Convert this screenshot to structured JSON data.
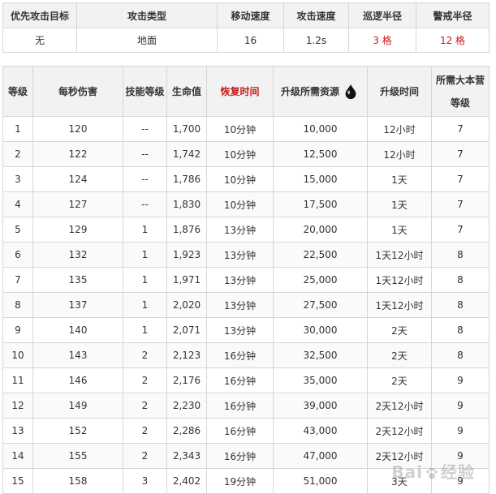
{
  "top": {
    "headers": [
      "优先攻击目标",
      "攻击类型",
      "移动速度",
      "攻击速度",
      "巡逻半径",
      "警戒半径"
    ],
    "values": [
      "无",
      "地面",
      "16",
      "1.2s",
      "3 格",
      "12 格"
    ]
  },
  "table": {
    "headers": [
      "等级",
      "每秒伤害",
      "技能等级",
      "生命值",
      "恢复时间",
      "升级所需资源",
      "升级时间",
      "所需大本营等级"
    ],
    "rows": [
      [
        "1",
        "120",
        "--",
        "1,700",
        "10分钟",
        "10,000",
        "12小时",
        "7"
      ],
      [
        "2",
        "122",
        "--",
        "1,742",
        "10分钟",
        "12,500",
        "12小时",
        "7"
      ],
      [
        "3",
        "124",
        "--",
        "1,786",
        "10分钟",
        "15,000",
        "1天",
        "7"
      ],
      [
        "4",
        "127",
        "--",
        "1,830",
        "10分钟",
        "17,500",
        "1天",
        "7"
      ],
      [
        "5",
        "129",
        "1",
        "1,876",
        "13分钟",
        "20,000",
        "1天",
        "7"
      ],
      [
        "6",
        "132",
        "1",
        "1,923",
        "13分钟",
        "22,500",
        "1天12小时",
        "8"
      ],
      [
        "7",
        "135",
        "1",
        "1,971",
        "13分钟",
        "25,000",
        "1天12小时",
        "8"
      ],
      [
        "8",
        "137",
        "1",
        "2,020",
        "13分钟",
        "27,500",
        "1天12小时",
        "8"
      ],
      [
        "9",
        "140",
        "1",
        "2,071",
        "13分钟",
        "30,000",
        "2天",
        "8"
      ],
      [
        "10",
        "143",
        "2",
        "2,123",
        "16分钟",
        "32,500",
        "2天",
        "8"
      ],
      [
        "11",
        "146",
        "2",
        "2,176",
        "16分钟",
        "35,000",
        "2天",
        "9"
      ],
      [
        "12",
        "149",
        "2",
        "2,230",
        "16分钟",
        "39,000",
        "2天12小时",
        "9"
      ],
      [
        "13",
        "152",
        "2",
        "2,286",
        "16分钟",
        "43,000",
        "2天12小时",
        "9"
      ],
      [
        "14",
        "155",
        "2",
        "2,343",
        "16分钟",
        "47,000",
        "2天12小时",
        "9"
      ],
      [
        "15",
        "158",
        "3",
        "2,402",
        "19分钟",
        "51,000",
        "3天",
        "9"
      ]
    ]
  },
  "watermark": {
    "text_left": "Bai",
    "text_right": "经验"
  },
  "icons": {
    "resource": "dark-elixir-drop-icon",
    "watermark": "paw-icon"
  },
  "colors": {
    "header_bg": "#f2f2f2",
    "border": "#d6d6d6",
    "accent_red": "#cc1a1a"
  }
}
